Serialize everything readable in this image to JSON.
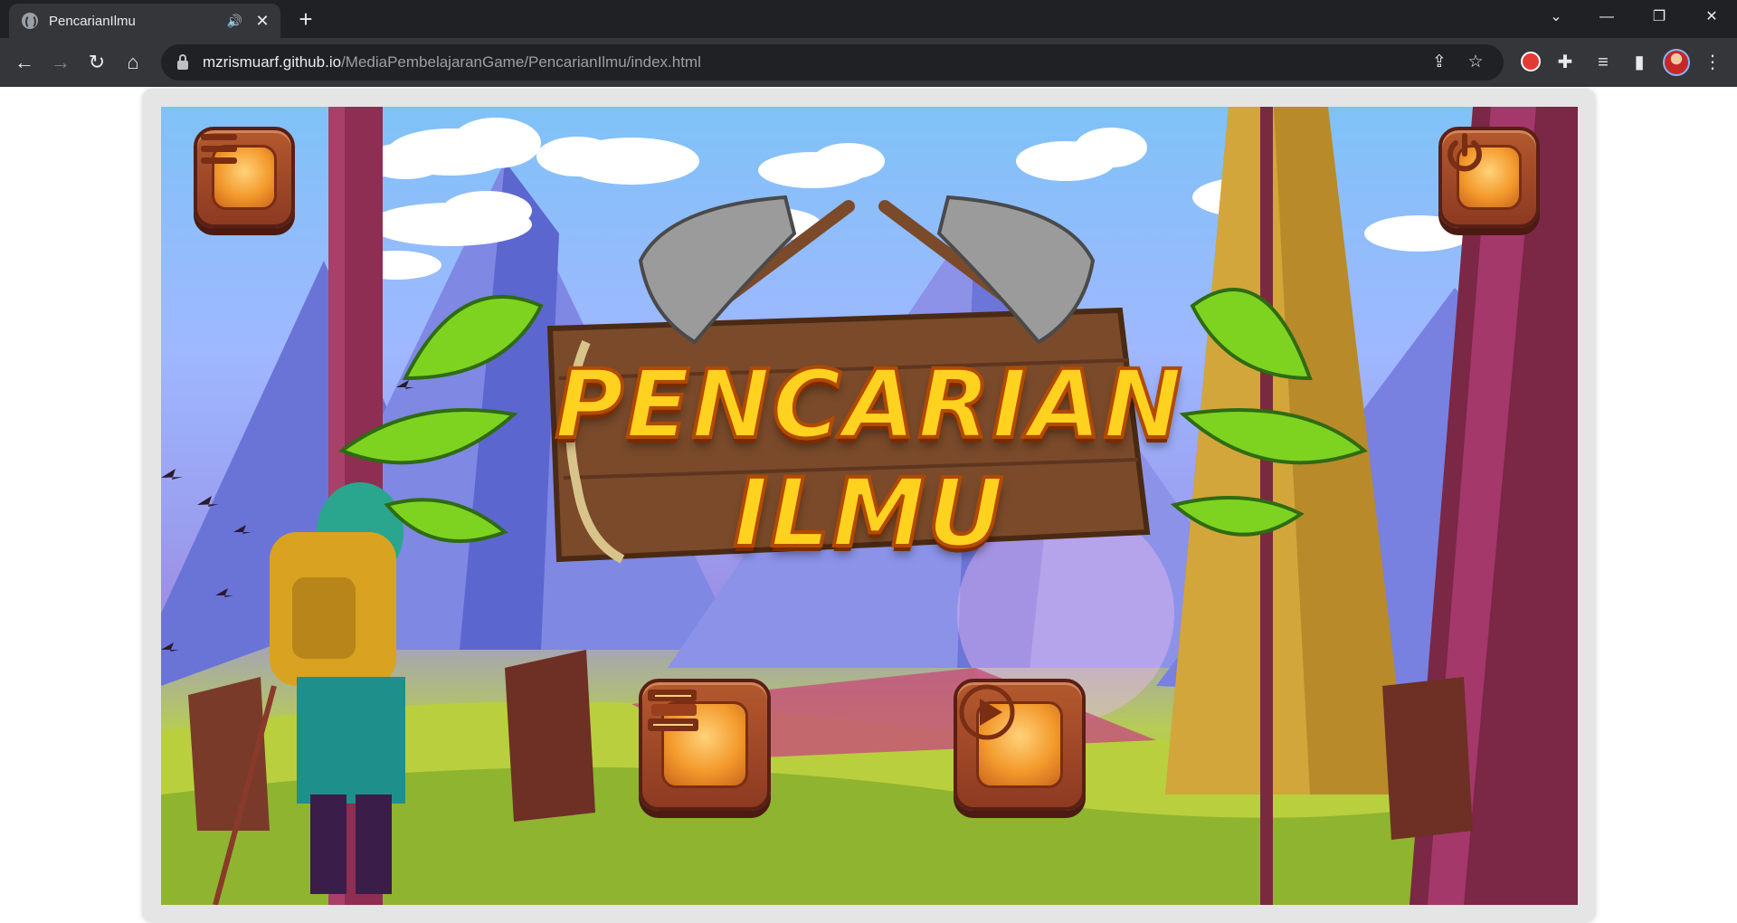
{
  "browser": {
    "tab_title": "PencarianIlmu",
    "speaker_icon": "🔊",
    "close_icon": "✕",
    "newtab_icon": "+",
    "url_host": "mzrismuarf.github.io",
    "url_path": "/MediaPembelajaranGame/PencarianIlmu/index.html",
    "window": {
      "tab_search": "⌄",
      "minimize": "—",
      "restore": "❐",
      "close": "✕"
    }
  },
  "game": {
    "title_line1": "PENCARIAN",
    "title_line2": "ILMU",
    "buttons": {
      "menu": "menu",
      "power": "power",
      "books": "books",
      "play": "play"
    }
  },
  "colors": {
    "title_fill": "#ffd21f",
    "title_outline": "#b14a00",
    "button_wood": "#8d3a22",
    "button_face": "#f39a2c"
  }
}
